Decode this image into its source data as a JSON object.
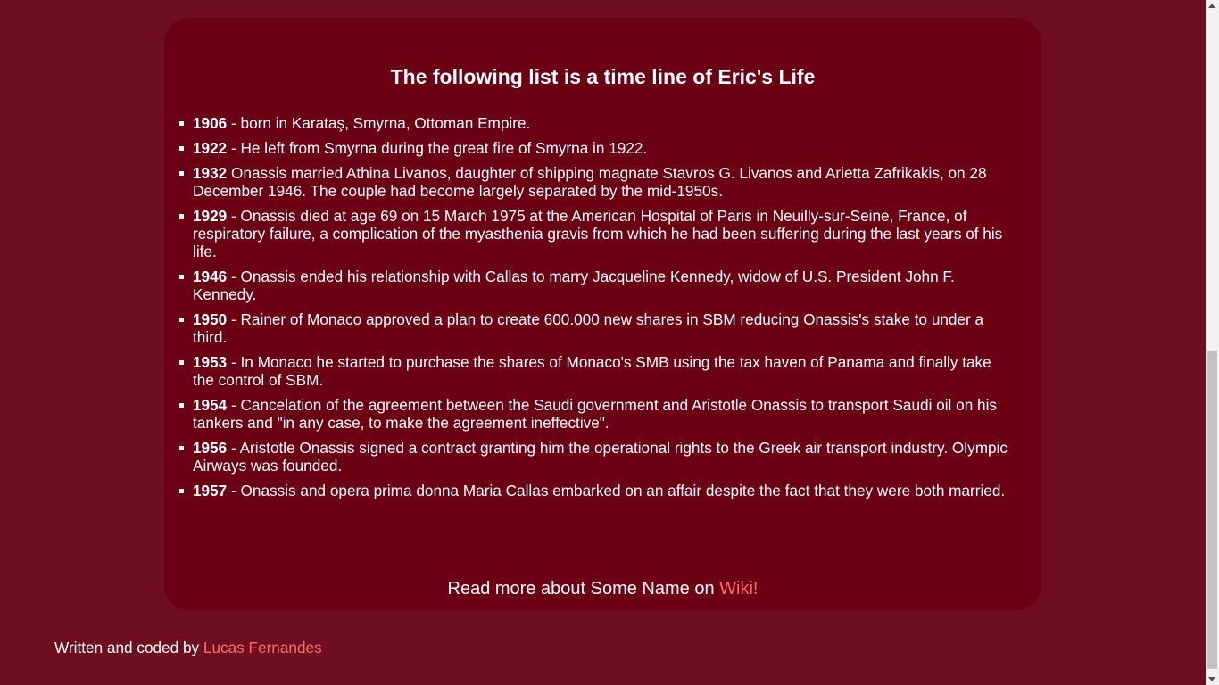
{
  "card": {
    "title": "The following list is a time line of Eric's Life",
    "timeline": [
      {
        "year": "1906",
        "text": " - born in Karataş, Smyrna, Ottoman Empire."
      },
      {
        "year": "1922",
        "text": " - He left from Smyrna during the great fire of Smyrna in 1922."
      },
      {
        "year": "1932",
        "text": " Onassis married Athina Livanos, daughter of shipping magnate Stavros G. Livanos and Arietta Zafrikakis, on 28 December 1946. The couple had become largely separated by the mid-1950s."
      },
      {
        "year": "1929",
        "text": " - Onassis died at age 69 on 15 March 1975 at the American Hospital of Paris in Neuilly-sur-Seine, France, of respiratory failure, a complication of the myasthenia gravis from which he had been suffering during the last years of his life."
      },
      {
        "year": "1946",
        "text": " - Onassis ended his relationship with Callas to marry Jacqueline Kennedy, widow of U.S. President John F. Kennedy."
      },
      {
        "year": "1950",
        "text": " - Rainer of Monaco approved a plan to create 600.000 new shares in SBM reducing Onassis's stake to under a third."
      },
      {
        "year": "1953",
        "text": " - In Monaco he started to purchase the shares of Monaco's SMB using the tax haven of Panama and finally take the control of SBM."
      },
      {
        "year": "1954",
        "text": " - Cancelation of the agreement between the Saudi government and Aristotle Onassis to transport Saudi oil on his tankers and \"in any case, to make the agreement ineffective\"."
      },
      {
        "year": "1956",
        "text": " - Aristotle Onassis signed a contract granting him the operational rights to the Greek air transport industry. Olympic Airways was founded."
      },
      {
        "year": "1957",
        "text": " - Onassis and opera prima donna Maria Callas embarked on an affair despite the fact that they were both married."
      }
    ],
    "read_more_prefix": "Read more about Some Name on ",
    "read_more_link": "Wiki!"
  },
  "footer": {
    "prefix": "Written and coded by ",
    "author_link": "Lucas Fernandes"
  },
  "colors": {
    "page_background": "#6d0f1e",
    "card_background": "#6b0014",
    "text": "#ffffff",
    "link": "#ff6b6b"
  }
}
